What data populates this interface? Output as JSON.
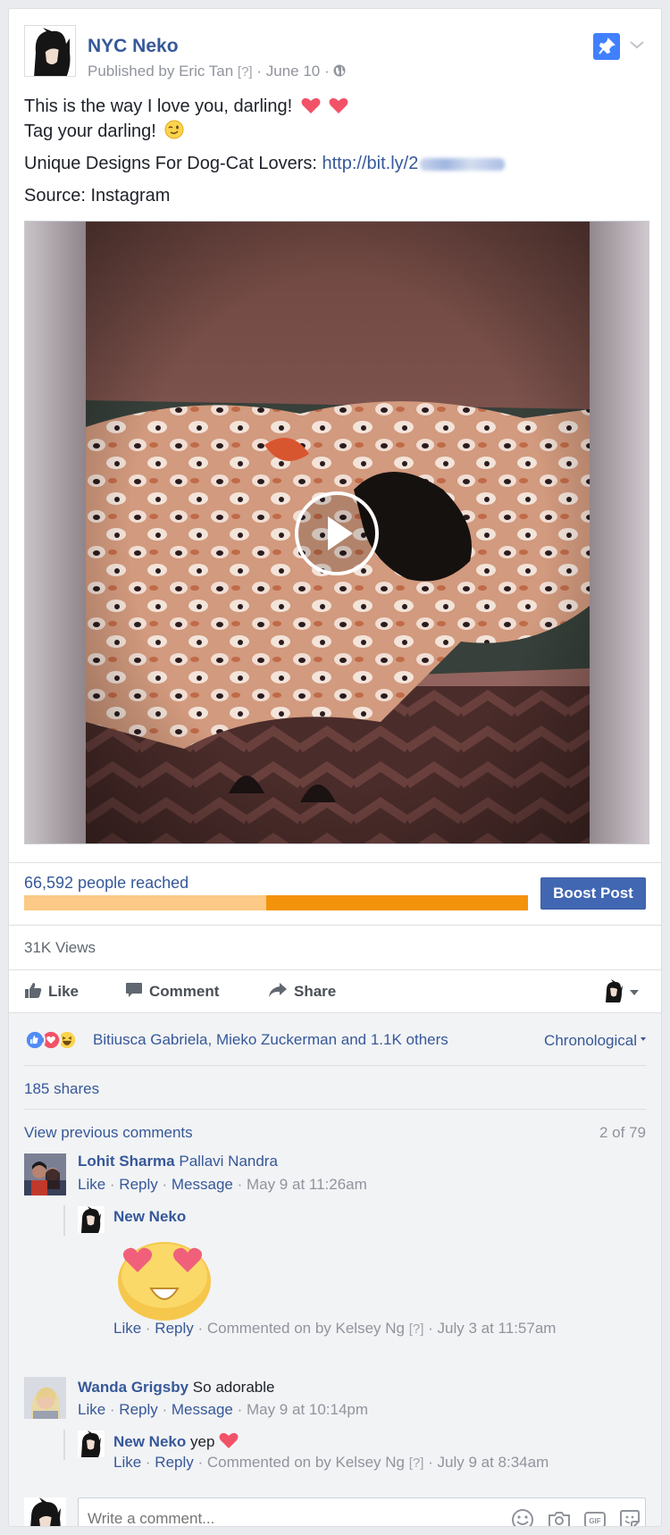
{
  "post": {
    "page_name": "NYC Neko",
    "published_by": "Published by Eric Tan",
    "unknown_mark": "[?]",
    "separator": "·",
    "date": "June 10",
    "text_line1": "This is the way I love you, darling!",
    "text_line2": "Tag your darling!",
    "text_line3": "Unique Designs For Dog-Cat Lovers:",
    "link": "http://bit.ly/2",
    "text_line4": "Source: Instagram"
  },
  "stats": {
    "reached": "66,592 people reached",
    "reach_fraction": 0.52,
    "boost_label": "Boost Post",
    "views": "31K Views"
  },
  "actions": {
    "like": "Like",
    "comment": "Comment",
    "share": "Share"
  },
  "reactions": {
    "names": "Bitiusca Gabriela, Mieko Zuckerman and 1.1K others",
    "sort": "Chronological",
    "shares": "185 shares"
  },
  "comments_header": {
    "view_previous": "View previous comments",
    "pager": "2 of 79"
  },
  "comments": [
    {
      "author": "Lohit Sharma",
      "text": "Pallavi Nandra",
      "like": "Like",
      "reply": "Reply",
      "message": "Message",
      "time": "May 9 at 11:26am"
    },
    {
      "author": "Wanda Grigsby",
      "text": "So adorable",
      "like": "Like",
      "reply": "Reply",
      "message": "Message",
      "time": "May 9 at 10:14pm"
    }
  ],
  "replies": [
    {
      "author": "New Neko",
      "text": "",
      "like": "Like",
      "reply": "Reply",
      "commented_on": "Commented on by Kelsey Ng",
      "unknown_mark": "[?]",
      "time": "July 3 at 11:57am"
    },
    {
      "author": "New Neko",
      "text": "yep",
      "like": "Like",
      "reply": "Reply",
      "commented_on": "Commented on by Kelsey Ng",
      "unknown_mark": "[?]",
      "time": "July 9 at 8:34am"
    }
  ],
  "composer": {
    "placeholder": "Write a comment..."
  },
  "colors": {
    "link": "#365899",
    "boost": "#4267b2",
    "bar_fill": "#f3920b",
    "bar_track": "#fcc987",
    "pin": "#4080ff"
  },
  "icons": [
    "pin-icon",
    "chevron-down-icon",
    "globe-icon",
    "heart-icon",
    "wink-emoji-icon",
    "play-icon",
    "like-icon",
    "comment-icon",
    "share-icon",
    "love-reaction-icon",
    "haha-reaction-icon",
    "heart-eyes-sticker",
    "smiley-icon",
    "camera-icon",
    "gif-icon",
    "sticker-icon"
  ]
}
